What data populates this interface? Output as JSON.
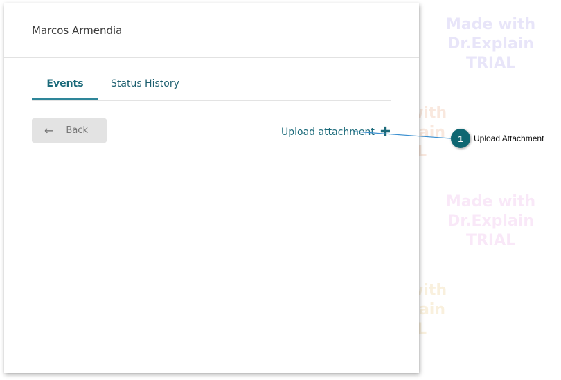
{
  "header": {
    "title": "Marcos Armendia"
  },
  "tabs": [
    {
      "label": "Events",
      "active": true
    },
    {
      "label": "Status History",
      "active": false
    }
  ],
  "actions": {
    "back_label": "Back",
    "upload_label": "Upload attachment"
  },
  "callout": {
    "number": "1",
    "label": "Upload Attachment"
  },
  "watermark": {
    "line1": "Made with",
    "line2": "Dr.Explain",
    "line3": "TRIAL"
  },
  "colors": {
    "accent": "#1b6a7a",
    "callout": "#0f6772"
  }
}
